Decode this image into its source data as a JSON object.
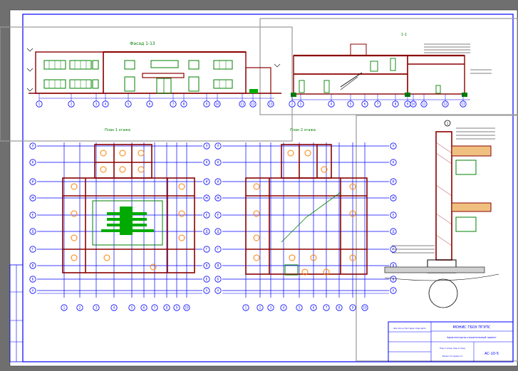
{
  "sheet": {
    "facade_title": "Фасад 1-13",
    "section_title": "1-1",
    "plan1_title": "План 1 этажа",
    "plan2_title": "План 2 этажа",
    "detail_label": "1"
  },
  "facade_axes": [
    "1",
    "2",
    "3",
    "4",
    "5",
    "6",
    "7",
    "8",
    "9",
    "10",
    "11",
    "12",
    "13"
  ],
  "section_axes": [
    "2",
    "3",
    "4",
    "5",
    "6",
    "7",
    "8",
    "9",
    "10",
    "11",
    "12",
    "13"
  ],
  "plan1_bottom_axes": [
    "1",
    "2",
    "3",
    "4",
    "5",
    "6",
    "7",
    "8",
    "9",
    "10",
    "11",
    "12",
    "13"
  ],
  "plan_side_axes": [
    "А",
    "Б",
    "В",
    "Г",
    "Д",
    "Е",
    "Ж",
    "И",
    "К",
    "Л"
  ],
  "plan2_bottom_axes": [
    "1",
    "2",
    "3",
    "4",
    "5",
    "6",
    "7",
    "8",
    "9",
    "10",
    "11",
    "12",
    "13"
  ],
  "title_block": {
    "school": "МОНИС ГБОУ ПГУПС",
    "project": "Архитектурно-строительный проект",
    "code": "АС-10-5",
    "row1": "Изм. Кол.уч Лист №док. Подп. Дата",
    "row2": "План 1 этажа, план 2 этажа",
    "row3": "Фасад 1-13, разрез 1-1"
  },
  "colors": {
    "paper": "#ffffff",
    "frame": "#0000ff",
    "wall": "#8b0000",
    "grid": "#0000ff",
    "green": "#008000",
    "window": "#00aa00",
    "note": "#000000",
    "orange": "#ff8000"
  }
}
